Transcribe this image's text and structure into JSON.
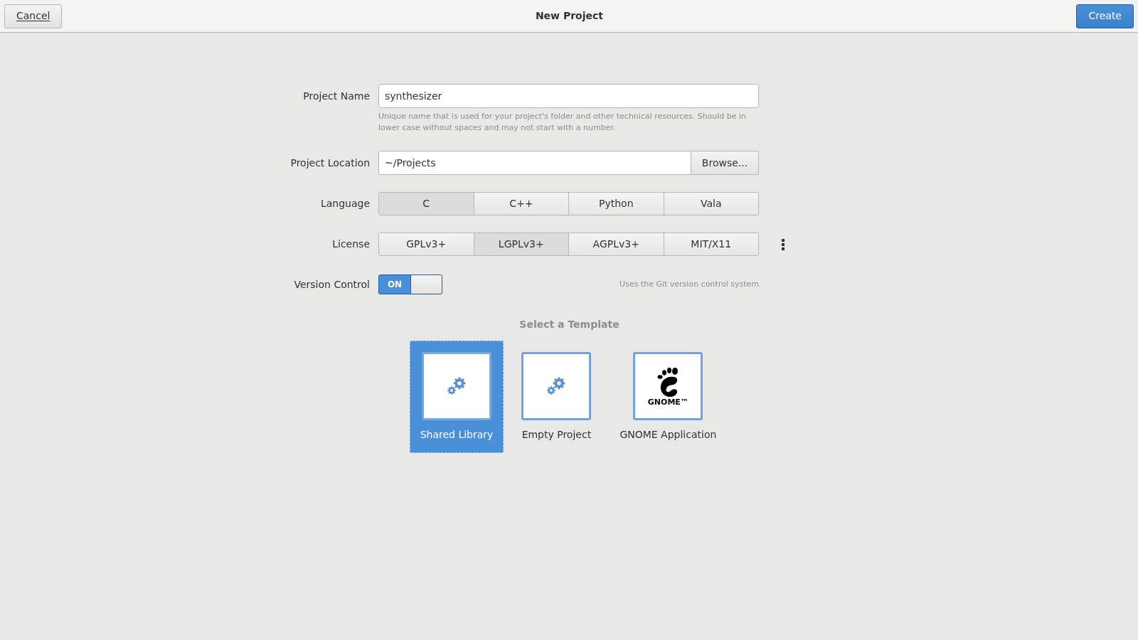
{
  "header": {
    "cancel": "Cancel",
    "title": "New Project",
    "create": "Create"
  },
  "form": {
    "project_name": {
      "label": "Project Name",
      "value": "synthesizer",
      "help": "Unique name that is used for your project's folder and other technical resources. Should be in lower case without spaces and may not start with a number."
    },
    "project_location": {
      "label": "Project Location",
      "value": "~/Projects",
      "browse": "Browse..."
    },
    "language": {
      "label": "Language",
      "options": [
        {
          "label": "C",
          "selected": true
        },
        {
          "label": "C++",
          "selected": false
        },
        {
          "label": "Python",
          "selected": false
        },
        {
          "label": "Vala",
          "selected": false
        }
      ]
    },
    "license": {
      "label": "License",
      "options": [
        {
          "label": "GPLv3+",
          "selected": false
        },
        {
          "label": "LGPLv3+",
          "selected": true
        },
        {
          "label": "AGPLv3+",
          "selected": false
        },
        {
          "label": "MIT/X11",
          "selected": false
        }
      ]
    },
    "version_control": {
      "label": "Version Control",
      "on": true,
      "state_text": "ON",
      "hint": "Uses the Git version control system"
    }
  },
  "templates": {
    "title": "Select a Template",
    "items": [
      {
        "label": "Shared Library",
        "kind": "gears",
        "selected": true
      },
      {
        "label": "Empty Project",
        "kind": "gears",
        "selected": false
      },
      {
        "label": "GNOME Application",
        "kind": "gnome",
        "logo_text": "GNOME™",
        "selected": false
      }
    ]
  }
}
